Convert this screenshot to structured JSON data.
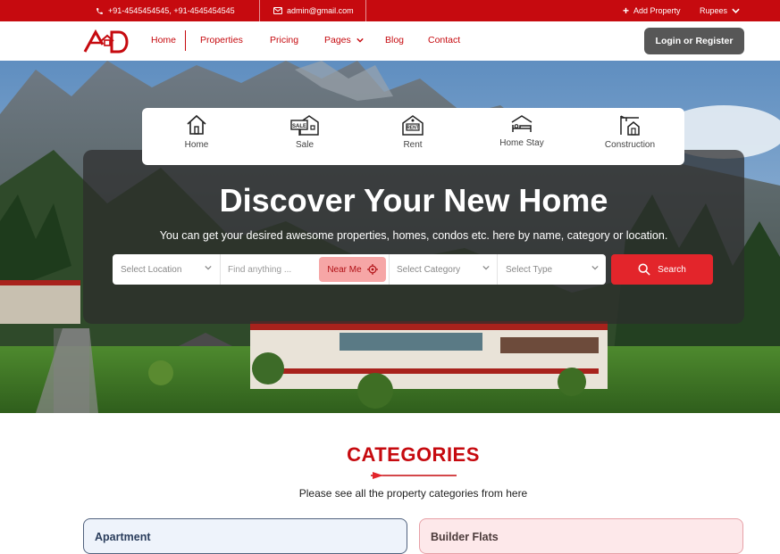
{
  "topbar": {
    "phones": "+91-4545454545, +91-4545454545",
    "email": "admin@gmail.com",
    "add_property": "Add Property",
    "currency": "Rupees"
  },
  "nav": {
    "logo_text": "AD",
    "items": [
      "Home",
      "Properties",
      "Pricing",
      "Pages",
      "Blog",
      "Contact"
    ],
    "login": "Login or Register"
  },
  "hero": {
    "tabs": [
      {
        "label": "Home",
        "icon": "house-icon"
      },
      {
        "label": "Sale",
        "icon": "sale-sign-icon"
      },
      {
        "label": "Rent",
        "icon": "rent-sign-icon"
      },
      {
        "label": "Home Stay",
        "icon": "bed-house-icon"
      },
      {
        "label": "Construction",
        "icon": "crane-building-icon"
      }
    ],
    "title": "Discover Your New Home",
    "subtitle": "You can get your desired awesome properties, homes, condos etc. here by name, category or location.",
    "search": {
      "location": "Select Location",
      "keyword_placeholder": "Find anything ...",
      "near_me": "Near Me",
      "category": "Select Category",
      "type": "Select Type",
      "button": "Search"
    }
  },
  "categories": {
    "title": "CATEGORIES",
    "description": "Please see all the property categories from here",
    "cards": [
      "Apartment",
      "Builder Flats"
    ]
  },
  "colors": {
    "brand_red": "#c60a0f",
    "search_red": "#e3252b",
    "login_gray": "#575757"
  }
}
